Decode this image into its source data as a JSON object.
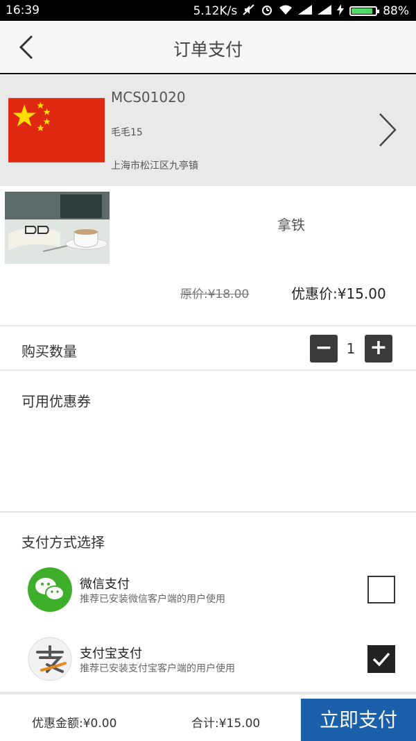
{
  "status_bar": {
    "time": "16:39",
    "network_speed": "5.12K/s",
    "battery_percent": "88%",
    "battery_level": 0.88,
    "icons": [
      "mute-icon",
      "alarm-icon",
      "wifi-icon",
      "signal-icon",
      "signal-icon",
      "charging-icon",
      "battery-icon"
    ]
  },
  "header": {
    "title": "订单支付",
    "back_icon": "back-chevron-icon"
  },
  "address": {
    "code": "MCS01020",
    "name": "毛毛15",
    "place": "上海市松江区九亭镇",
    "flag_icon": "china-flag-icon",
    "chevron_icon": "chevron-right-icon"
  },
  "product": {
    "name": "拿铁",
    "original_price": "原价:¥18.00",
    "discount_price": "优惠价:¥15.00"
  },
  "quantity": {
    "label": "购买数量",
    "minus": "−",
    "value": "1",
    "plus": "+"
  },
  "coupons": {
    "label": "可用优惠券"
  },
  "payment": {
    "label": "支付方式选择",
    "methods": [
      {
        "title": "微信支付",
        "desc": "推荐已安装微信客户端的用户使用",
        "icon": "wechat-icon",
        "checked": false
      },
      {
        "title": "支付宝支付",
        "desc": "推荐已安装支付宝客户端的用户使用",
        "icon": "alipay-icon",
        "checked": true
      }
    ]
  },
  "bottom": {
    "discount_amount": "优惠金额:¥0.00",
    "total": "合计:¥15.00",
    "pay_button": "立即支付"
  },
  "colors": {
    "pay_button_bg": "#1a5faa",
    "wechat_green": "#3fae2a",
    "flag_red": "#de2910",
    "flag_yellow": "#ffde00"
  }
}
